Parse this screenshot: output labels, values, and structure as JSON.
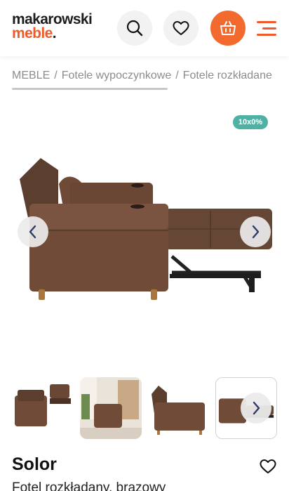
{
  "header": {
    "logo_line1": "makarowski",
    "logo_line2": "meble",
    "logo_dot": ".",
    "icons": [
      "search-icon",
      "heart-icon",
      "basket-icon",
      "hamburger-menu-icon"
    ],
    "accent_color": "#f05a28",
    "cart_color": "#f26a2e"
  },
  "breadcrumb": {
    "items": [
      "MEBLE",
      "Fotele wypoczynkowe",
      "Fotele rozkładane"
    ],
    "separator": "/"
  },
  "gallery": {
    "badge": "10x0%",
    "badge_color": "#4fb1a4",
    "prev_icon": "chevron-left-icon",
    "next_icon": "chevron-right-icon",
    "thumbnail_count": 4
  },
  "product": {
    "name": "Solor",
    "subtitle": "Fotel rozkładany, brązowy",
    "favorite_icon": "heart-outline-icon"
  }
}
